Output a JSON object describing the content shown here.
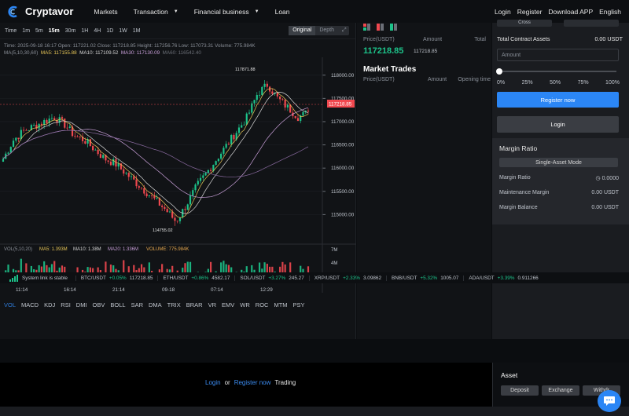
{
  "nav": {
    "brand": "Cryptavor",
    "links": [
      "Markets",
      "Transaction",
      "Financial business",
      "Loan"
    ],
    "right": [
      "Login",
      "Register",
      "Download APP",
      "English"
    ]
  },
  "chart": {
    "timeframes": [
      "Time",
      "1m",
      "5m",
      "15m",
      "30m",
      "1H",
      "4H",
      "1D",
      "1W",
      "1M"
    ],
    "active_timeframe": "15m",
    "view_original": "Original",
    "view_depth": "Depth",
    "info_line": "Time: 2025-09-18 16:17   Open: 117221.02   Close: 117218.85   Height: 117256.76   Low: 117073.31   Volume: 775.984K",
    "ma_label": "MA(5,10,30,60)",
    "ma5": "MA5: 117155.88",
    "ma10": "MA10: 117109.52",
    "ma30": "MA30: 117130.09",
    "ma60": "MA60: 116542.40",
    "price_ticks": [
      "118000.00",
      "117500.00",
      "117000.00",
      "116500.00",
      "116000.00",
      "115500.00",
      "115000.00"
    ],
    "current_price": "117218.85",
    "high_label": "117871.88",
    "low_label": "114755.02",
    "vol_label": "VOL(5,10,20)",
    "vol_ma5": "MA5: 1.393M",
    "vol_ma10": "MA10: 1.38M",
    "vol_ma20": "MA20: 1.336M",
    "vol_value": "VOLUME: 775.984K",
    "vol_ticks": [
      "7M",
      "4M"
    ],
    "time_ticks": [
      "11:14",
      "16:14",
      "21:14",
      "09-18",
      "07:14",
      "12:29"
    ],
    "indicators": [
      "VOL",
      "MACD",
      "KDJ",
      "RSI",
      "DMI",
      "OBV",
      "BOLL",
      "SAR",
      "DMA",
      "TRIX",
      "BRAR",
      "VR",
      "EMV",
      "WR",
      "ROC",
      "MTM",
      "PSY"
    ],
    "active_indicator": "VOL"
  },
  "chart_data": {
    "type": "candlestick",
    "y_range": [
      114500,
      118300
    ],
    "candles_close_path_summary": [
      116200,
      116600,
      116800,
      116900,
      117000,
      117100,
      116950,
      116700,
      116600,
      116400,
      116200,
      116100,
      115900,
      115700,
      115500,
      115300,
      115100,
      114850,
      115200,
      115600,
      115900,
      116200,
      116500,
      116800,
      117100,
      117600,
      117800,
      117500,
      117300,
      117100,
      117200
    ],
    "high": 117871.88,
    "low": 114755.02,
    "last": 117218.85
  },
  "orderbook": {
    "price_head": "Price(USDT)",
    "amount_head": "Amount",
    "total_head": "Total",
    "last_price": "117218.85",
    "last_sub": "117218.85",
    "market_trades_title": "Market Trades",
    "mt_price": "Price(USDT)",
    "mt_amount": "Amount",
    "mt_time": "Opening time"
  },
  "trade": {
    "top_left": "Cross",
    "top_right": "",
    "tca_label": "Total Contract Assets",
    "tca_value": "0.00 USDT",
    "amount_placeholder": "Amount",
    "percent_ticks": [
      "0%",
      "25%",
      "50%",
      "75%",
      "100%"
    ],
    "register_btn": "Register now",
    "login_btn": "Login",
    "margin_title": "Margin Ratio",
    "mode_btn": "Single-Asset Mode",
    "margin_ratio_label": "Margin Ratio",
    "margin_ratio_value": "0.0000",
    "maint_label": "Maintenance Margin",
    "maint_value": "0.00 USDT",
    "balance_label": "Margin Balance",
    "balance_value": "0.00 USDT"
  },
  "ticker": {
    "status": "System link is stable",
    "items": [
      {
        "pair": "BTC/USDT",
        "change": "+0.05%",
        "price": "117218.85"
      },
      {
        "pair": "ETH/USDT",
        "change": "+0.86%",
        "price": "4582.17"
      },
      {
        "pair": "SOL/USDT",
        "change": "+3.27%",
        "price": "245.27"
      },
      {
        "pair": "XRP/USDT",
        "change": "+2.33%",
        "price": "3.09862"
      },
      {
        "pair": "BNB/USDT",
        "change": "+5.32%",
        "price": "1005.07"
      },
      {
        "pair": "ADA/USDT",
        "change": "+3.39%",
        "price": "0.911266"
      }
    ]
  },
  "footer": {
    "login": "Login",
    "or": "or",
    "register": "Register now",
    "trading": "Trading"
  },
  "asset": {
    "title": "Asset",
    "deposit": "Deposit",
    "exchange": "Exchange",
    "withdraw": "Withdr"
  }
}
